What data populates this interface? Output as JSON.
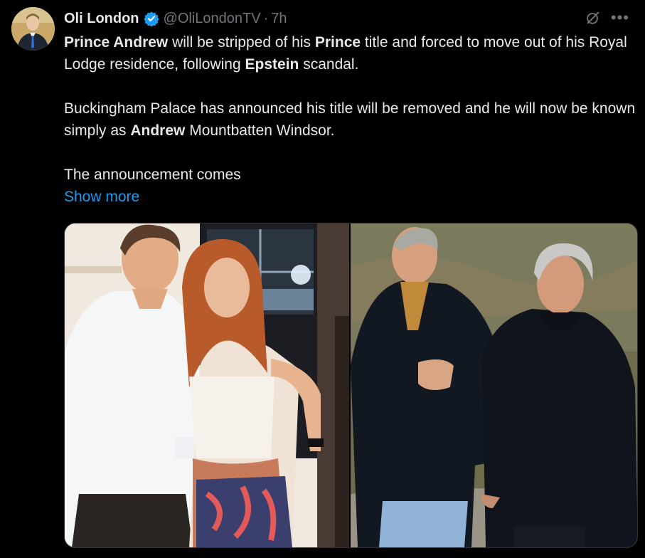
{
  "author": {
    "name": "Oli London",
    "handle": "@OliLondonTV",
    "separator": "·",
    "time": "7h",
    "verified": true
  },
  "tweet": {
    "p1": [
      {
        "t": "Prince Andrew",
        "b": true
      },
      {
        "t": " will be stripped of his ",
        "b": false
      },
      {
        "t": "Prince",
        "b": true
      },
      {
        "t": " title and forced to move out of his Royal Lodge residence, following ",
        "b": false
      },
      {
        "t": "Epstein",
        "b": true
      },
      {
        "t": " scandal.",
        "b": false
      }
    ],
    "p2": [
      {
        "t": "Buckingham Palace has announced his title will be removed and he will now be known simply as ",
        "b": false
      },
      {
        "t": "Andrew",
        "b": true
      },
      {
        "t": " Mountbatten Windsor.",
        "b": false
      }
    ],
    "p3": "The announcement comes",
    "show_more": "Show more"
  },
  "icons": {
    "verified": "verified-badge-icon",
    "grok": "grok-icon",
    "more": "more-icon"
  },
  "colors": {
    "background": "#000000",
    "text": "#e7e9ea",
    "muted": "#71767b",
    "link": "#1d9bf0",
    "verified": "#1d9bf0"
  }
}
